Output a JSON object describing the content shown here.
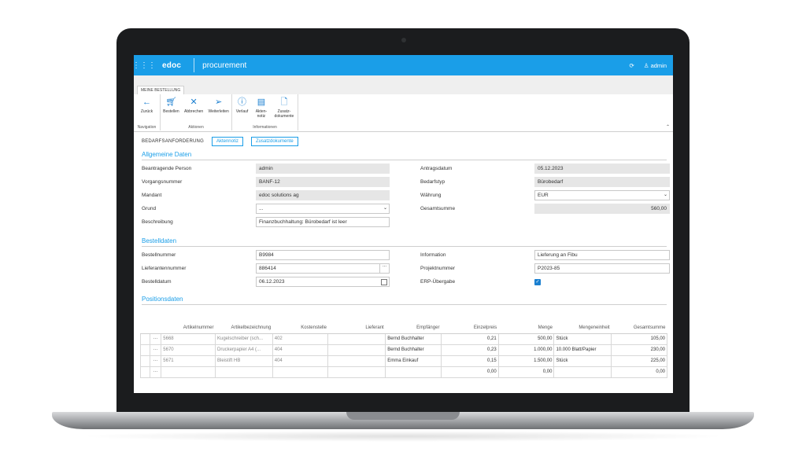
{
  "topbar": {
    "grid_icon": "grid-icon",
    "brand": "edoc",
    "app_name": "procurement",
    "refresh_icon": "refresh-icon",
    "user_label": "admin"
  },
  "ribbon": {
    "tab_label": "MEINE BESTELLUNG",
    "groups": {
      "navigation": "Navigation",
      "aktionen": "Aktionen",
      "informationen": "Informationen"
    },
    "buttons": {
      "zurueck": "Zurück",
      "bestellen": "Bestellen",
      "abbrechen": "Abbrechen",
      "weiterleiten": "Weiterleiten",
      "verlauf": "Verlauf",
      "aktennotiz_1": "Akten-",
      "aktennotiz_2": "notiz",
      "zusatz_1": "Zusatz-",
      "zusatz_2": "dokumente"
    }
  },
  "header": {
    "label": "BEDARFSANFORDERUNG",
    "aktennotiz_btn": "Aktennotiz",
    "zusatzdokumente_btn": "Zusatzdokumente"
  },
  "allgemein": {
    "title": "Allgemeine Daten",
    "beantragende_person_label": "Beantragende Person",
    "beantragende_person": "admin",
    "vorgangsnummer_label": "Vorgangsnummer",
    "vorgangsnummer": "BANF-12",
    "mandant_label": "Mandant",
    "mandant": "edoc solutions ag",
    "grund_label": "Grund",
    "grund": "...",
    "beschreibung_label": "Beschreibung",
    "beschreibung": "Finanzbuchhaltung: Bürobedarf ist leer",
    "antragsdatum_label": "Antragsdatum",
    "antragsdatum": "05.12.2023",
    "bedarfstyp_label": "Bedarfstyp",
    "bedarfstyp": "Bürobedarf",
    "waehrung_label": "Währung",
    "waehrung": "EUR",
    "gesamtsumme_label": "Gesamtsumme",
    "gesamtsumme": "560,00"
  },
  "bestell": {
    "title": "Bestelldaten",
    "bestellnummer_label": "Bestellnummer",
    "bestellnummer": "B9984",
    "lieferantennummer_label": "Lieferantennummer",
    "lieferantennummer": "886414",
    "bestelldatum_label": "Bestelldatum",
    "bestelldatum": "06.12.2023",
    "information_label": "Information",
    "information": "Lieferung an Fibu",
    "projektnummer_label": "Projektnummer",
    "projektnummer": "P2023-85",
    "erp_label": "ERP-Übergabe",
    "erp_checked": true
  },
  "positionen": {
    "title": "Positionsdaten",
    "columns": [
      "Artikelnummer",
      "Artikelbezeichnung",
      "Kostenstelle",
      "Lieferant",
      "Empfänger",
      "Einzelpreis",
      "Menge",
      "Mengeneinheit",
      "Gesamtsumme"
    ],
    "rows": [
      [
        "5668",
        "Kugelschreiber (sch...",
        "402",
        "",
        "Bernd Buchhalter",
        "0,21",
        "500,00",
        "Stück",
        "105,00"
      ],
      [
        "5670",
        "Druckerpapier A4 (...",
        "404",
        "",
        "Bernd Buchhalter",
        "0,23",
        "1.000,00",
        "10.000 Blatt/Papier",
        "230,00"
      ],
      [
        "5671",
        "Bleistift HB",
        "404",
        "",
        "Emma Einkauf",
        "0,15",
        "1.500,00",
        "Stück",
        "225,00"
      ],
      [
        "",
        "",
        "",
        "",
        "",
        "0,00",
        "0,00",
        "",
        "0,00"
      ]
    ],
    "row_menu": "···"
  }
}
